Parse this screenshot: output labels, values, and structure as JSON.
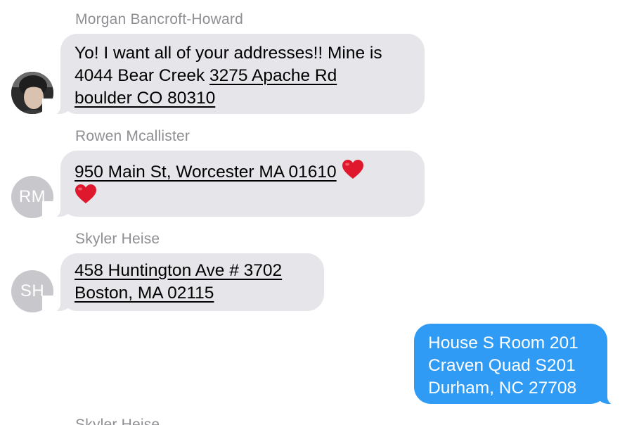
{
  "colors": {
    "incoming_bubble": "#e5e5ea",
    "outgoing_bubble": "#2f9bf4",
    "avatar_placeholder": "#c7c7cc",
    "sender_name": "#8e8e93"
  },
  "messages": [
    {
      "sender": "Morgan Bancroft-Howard",
      "avatar": "photo",
      "text_plain_1": "Yo! I want all of your addresses!! Mine is 4044 Bear Creek ",
      "link_1": "3275 Apache Rd",
      "link_2": "boulder CO 80310"
    },
    {
      "sender": "Rowen Mcallister",
      "avatar_initials": "RM",
      "link": "950 Main St, Worcester MA 01610",
      "emoji": [
        "heart",
        "heart"
      ]
    },
    {
      "sender": "Skyler Heise",
      "avatar_initials": "SH",
      "link_line_1": "458 Huntington Ave # 3702",
      "link_line_2": "Boston, MA 02115"
    },
    {
      "from_me": true,
      "line_1": "House S Room 201",
      "line_2": "Craven Quad S201",
      "line_3": "Durham, NC 27708"
    },
    {
      "sender": "Skyler Heise"
    }
  ]
}
